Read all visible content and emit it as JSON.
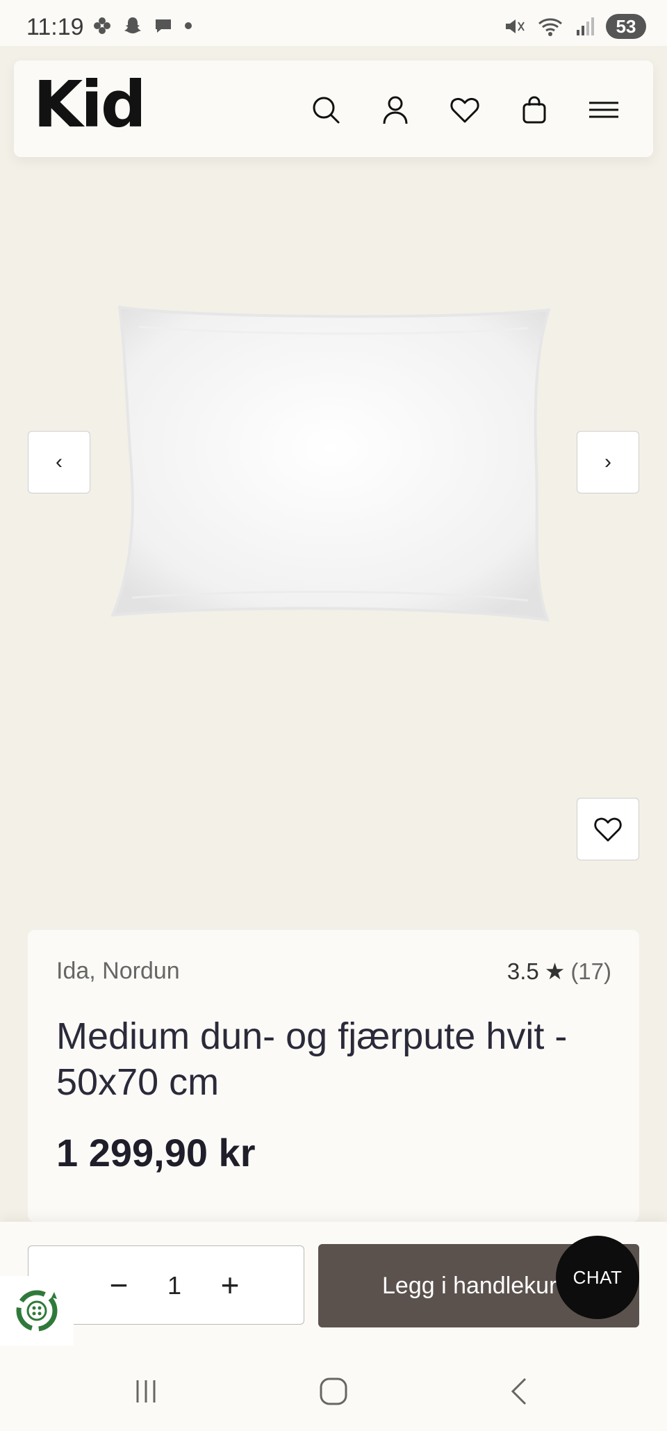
{
  "status_bar": {
    "time": "11:19",
    "battery": "53"
  },
  "header": {
    "logo": "Kid"
  },
  "gallery": {
    "prev_glyph": "‹",
    "next_glyph": "›"
  },
  "product": {
    "brand": "Ida, Nordun",
    "rating_value": "3.5",
    "rating_star": "★",
    "rating_count": "(17)",
    "title": "Medium dun- og fjærpute hvit - 50x70 cm",
    "price": "1 299,90 kr"
  },
  "cart_bar": {
    "minus": "−",
    "quantity": "1",
    "plus": "+",
    "add_to_cart_label": "Legg i handlekurv",
    "chat_label": "CHAT"
  },
  "colors": {
    "page_bg": "#f3f0e8",
    "card_bg": "#fbfaf6",
    "cart_button": "#5b524e",
    "chat_button": "#0d0d0d",
    "eco_green": "#2f7a3a"
  },
  "icons": [
    "search-icon",
    "account-icon",
    "heart-icon",
    "bag-icon",
    "menu-icon",
    "chevron-left-icon",
    "chevron-right-icon",
    "recycle-icon"
  ]
}
